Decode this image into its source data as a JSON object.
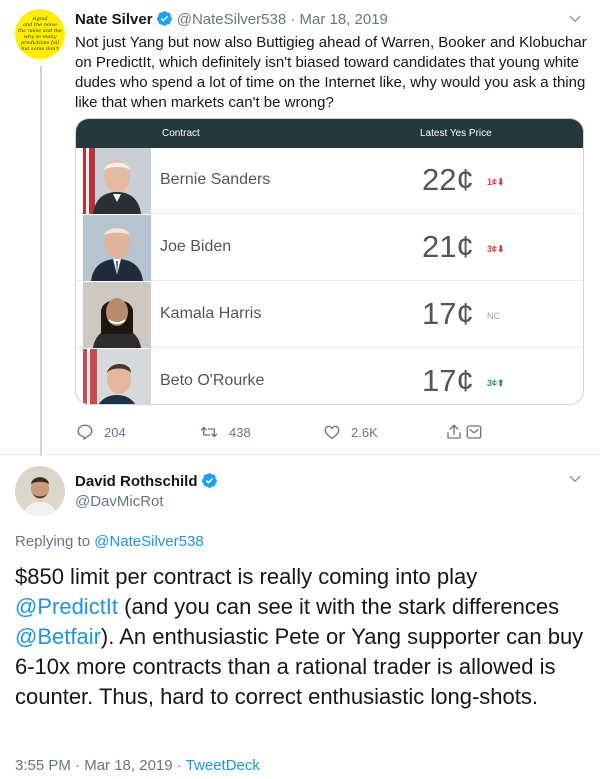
{
  "parent_tweet": {
    "author_name": "Nate Silver",
    "handle": "@NateSilver538",
    "separator": "·",
    "date": "Mar 18, 2019",
    "avatar_lines": [
      "signal",
      "and the noise",
      "the noise and the",
      "why so many",
      "predictions fail",
      "but some don't"
    ],
    "text": "Not just Yang but now also Buttigieg ahead of Warren, Booker and Klobuchar on PredictIt, which definitely isn't biased toward candidates that young white dudes who spend a lot of time on the Internet like, why would you ask a thing like that when markets can't be wrong?",
    "card": {
      "header_contract": "Contract",
      "header_price": "Latest Yes Price",
      "rows": [
        {
          "name": "Bernie Sanders",
          "price": "22¢",
          "change": "1¢",
          "direction": "down"
        },
        {
          "name": "Joe Biden",
          "price": "21¢",
          "change": "3¢",
          "direction": "down"
        },
        {
          "name": "Kamala Harris",
          "price": "17¢",
          "change": "NC",
          "direction": "none"
        },
        {
          "name": "Beto O'Rourke",
          "price": "17¢",
          "change": "3¢",
          "direction": "up"
        }
      ]
    },
    "actions": {
      "replies": "204",
      "retweets": "438",
      "likes": "2.6K"
    },
    "icons": [
      "verified-badge-icon",
      "chevron-down-icon",
      "reply-icon",
      "retweet-icon",
      "like-icon",
      "share-icon",
      "message-icon"
    ]
  },
  "reply_tweet": {
    "author_name": "David Rothschild",
    "handle": "@DavMicRot",
    "replying_prefix": "Replying to",
    "replying_to": "@NateSilver538",
    "text_parts": [
      {
        "text": "$850 limit per contract is really coming into play ",
        "link": false
      },
      {
        "text": "@PredictIt",
        "link": true
      },
      {
        "text": " (and you can see it with the stark differences ",
        "link": false
      },
      {
        "text": "@Betfair",
        "link": true
      },
      {
        "text": "). An enthusiastic Pete or Yang supporter can buy 6-10x more contracts than a rational trader is allowed is counter. Thus, hard to correct enthusiastic long-shots.",
        "link": false
      }
    ],
    "time": "3:55 PM",
    "separator": "·",
    "date": "Mar 18, 2019",
    "source": "TweetDeck"
  },
  "colors": {
    "link": "#1b95e0",
    "verified": "#1da1f2",
    "card_header": "#24383c",
    "down": "#d53a3a",
    "up": "#2e9a4d",
    "meta": "#657786"
  }
}
